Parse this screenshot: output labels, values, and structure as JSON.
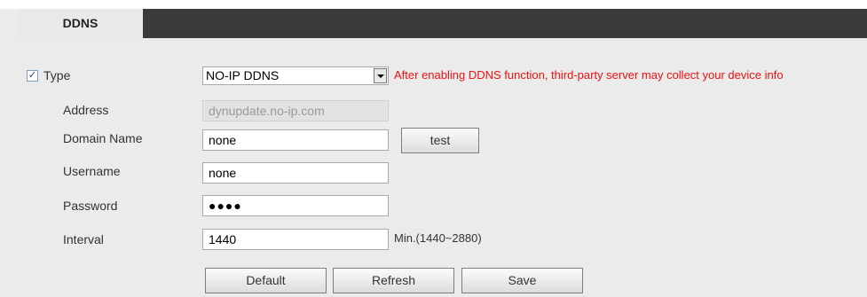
{
  "tab": {
    "label": "DDNS"
  },
  "form": {
    "type_label": "Type",
    "type_checked": true,
    "type_value": "NO-IP DDNS",
    "warning": "After enabling DDNS function, third-party server may collect your device info",
    "address_label": "Address",
    "address_placeholder": "dynupdate.no-ip.com",
    "domain_label": "Domain Name",
    "domain_value": "none",
    "test_label": "test",
    "username_label": "Username",
    "username_value": "none",
    "password_label": "Password",
    "password_value": "●●●●",
    "interval_label": "Interval",
    "interval_value": "1440",
    "interval_hint": "Min.(1440~2880)"
  },
  "buttons": {
    "default": "Default",
    "refresh": "Refresh",
    "save": "Save"
  },
  "colors": {
    "warning": "#ee1111",
    "tab_bar": "#3a3a3a",
    "background": "#ebebeb"
  }
}
